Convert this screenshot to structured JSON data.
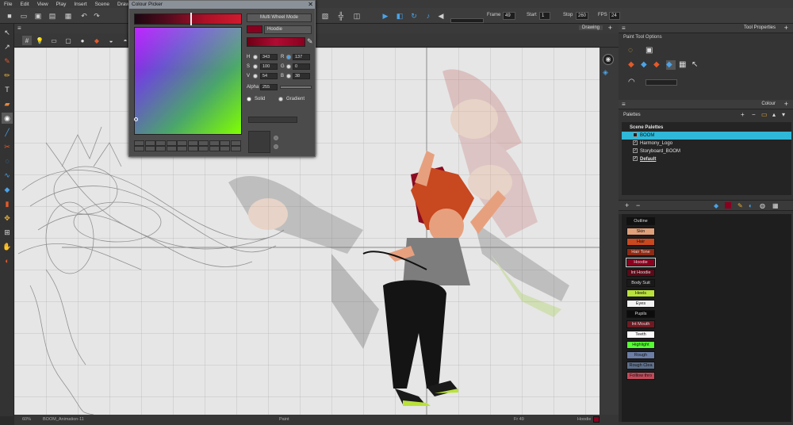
{
  "menu": [
    "File",
    "Edit",
    "View",
    "Play",
    "Insert",
    "Scene",
    "Drawing"
  ],
  "toolbar": {
    "frame_label": "Frame",
    "frame_value": "49",
    "start_label": "Start",
    "start_value": "1",
    "stop_label": "Stop",
    "stop_value": "260",
    "fps_label": "FPS",
    "fps_value": "24"
  },
  "view": {
    "title": "Drawing",
    "tab_plus": "+"
  },
  "colour_picker": {
    "title": "Colour Picker",
    "multi_wheel_label": "Multi Wheel Mode",
    "swatch_name": "Hoodie",
    "h_label": "H",
    "h_value": "343",
    "s_label": "S",
    "s_value": "100",
    "v_label": "V",
    "v_value": "54",
    "r_label": "R",
    "r_value": "137",
    "g_label": "G",
    "g_value": "0",
    "b_label": "B",
    "b_value": "38",
    "alpha_label": "Alpha",
    "alpha_value": "255",
    "solid_label": "Solid",
    "gradient_label": "Gradient"
  },
  "tool_properties": {
    "title": "Tool Properties",
    "section": "Paint Tool Options"
  },
  "colour_panel": {
    "title": "Colour",
    "palettes_label": "Palettes",
    "scene_palettes": "Scene Palettes",
    "palettes": [
      {
        "name": "BOOM",
        "checked": false,
        "selected": true
      },
      {
        "name": "Harmony_Logo",
        "checked": true,
        "selected": false
      },
      {
        "name": "Storyboard_BOOM",
        "checked": true,
        "selected": false
      },
      {
        "name": "Default",
        "checked": true,
        "selected": false
      }
    ],
    "swatches": [
      {
        "name": "Outline",
        "color": "#111111",
        "text": "#dddddd"
      },
      {
        "name": "Skin",
        "color": "#e0a07a",
        "text": "#111111"
      },
      {
        "name": "Hair",
        "color": "#c8481f",
        "text": "#111111"
      },
      {
        "name": "Hair Tone",
        "color": "#8f2a14",
        "text": "#dddddd"
      },
      {
        "name": "Hoodie",
        "color": "#89001f",
        "text": "#dddddd"
      },
      {
        "name": "Int Hoodie",
        "color": "#5a0a18",
        "text": "#dddddd"
      },
      {
        "name": "Body Suit",
        "color": "#1a1a1a",
        "text": "#dddddd"
      },
      {
        "name": "Heels",
        "color": "#b9e23a",
        "text": "#111111"
      },
      {
        "name": "Eyes",
        "color": "#f3f3f3",
        "text": "#111111"
      },
      {
        "name": "Pupils",
        "color": "#0c0c0c",
        "text": "#dddddd"
      },
      {
        "name": "Int Mouth",
        "color": "#6e1a22",
        "text": "#dddddd"
      },
      {
        "name": "Teeth",
        "color": "#fafafa",
        "text": "#111111"
      },
      {
        "name": "Highlight",
        "color": "#55ff33",
        "text": "#111111"
      },
      {
        "name": "Rough",
        "color": "#6c7ea6",
        "text": "#111111"
      },
      {
        "name": "Rough Clea",
        "color": "#5d6f8a",
        "text": "#111111"
      },
      {
        "name": "Folllow thro",
        "color": "#c24a5a",
        "text": "#111111"
      }
    ]
  },
  "status": {
    "zoom": "60%",
    "drawing": "BOOM_Animation-11",
    "tool": "Paint",
    "frame": "Fr 49",
    "colour": "Hoodie"
  }
}
